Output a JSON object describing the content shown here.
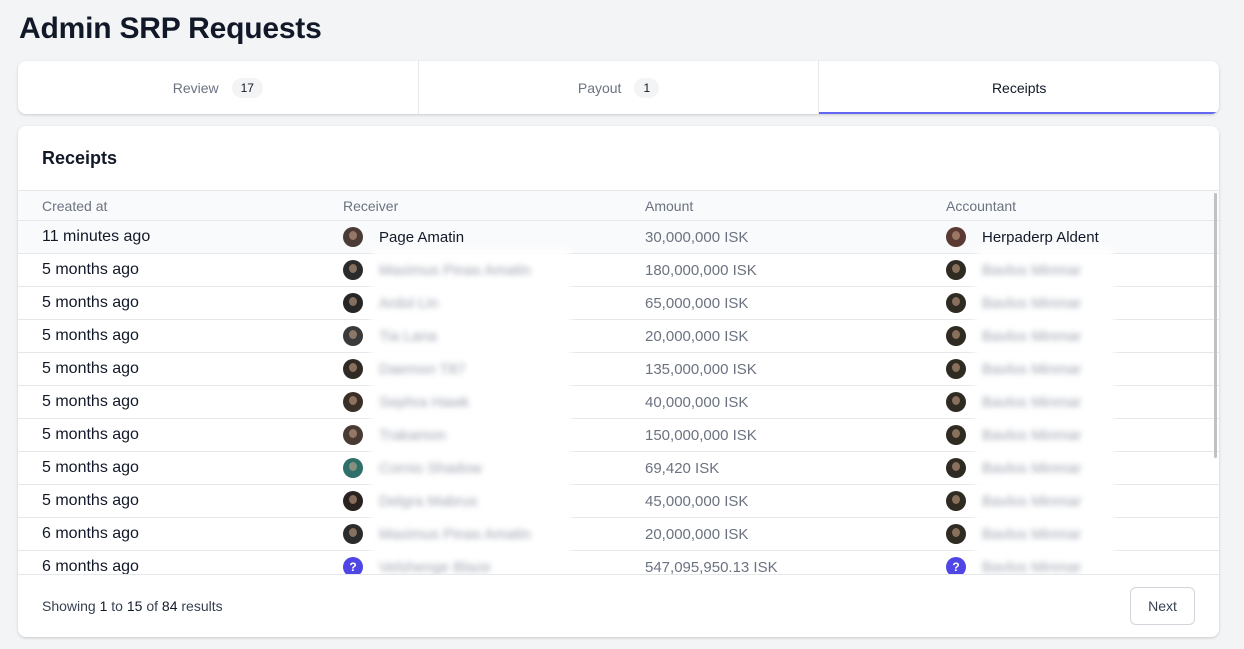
{
  "page": {
    "title": "Admin SRP Requests"
  },
  "tabs": [
    {
      "label": "Review",
      "badge": "17"
    },
    {
      "label": "Payout",
      "badge": "1"
    },
    {
      "label": "Receipts"
    }
  ],
  "receipts": {
    "title": "Receipts",
    "columns": {
      "created": "Created at",
      "receiver": "Receiver",
      "amount": "Amount",
      "accountant": "Accountant"
    },
    "rows": [
      {
        "created": "11 minutes ago",
        "receiver": "Page Amatin",
        "amount": "30,000,000 ISK",
        "accountant": "Herpaderp Aldent",
        "receiver_avatar_color": "#4a3b36",
        "accountant_avatar_color": "#5a3a32"
      },
      {
        "created": "5 months ago",
        "receiver": "Maximus Pinas Amatin",
        "amount": "180,000,000 ISK",
        "accountant": "Bavlos Minmar",
        "receiver_avatar_color": "#2b2b2b",
        "accountant_avatar_color": "#2f2a22"
      },
      {
        "created": "5 months ago",
        "receiver": "Ardol Lin",
        "amount": "65,000,000 ISK",
        "accountant": "Bavlos Minmar",
        "receiver_avatar_color": "#262626",
        "accountant_avatar_color": "#2f2a22"
      },
      {
        "created": "5 months ago",
        "receiver": "Tia Lana",
        "amount": "20,000,000 ISK",
        "accountant": "Bavlos Minmar",
        "receiver_avatar_color": "#3a3a3a",
        "accountant_avatar_color": "#2f2a22"
      },
      {
        "created": "5 months ago",
        "receiver": "Daemon T87",
        "amount": "135,000,000 ISK",
        "accountant": "Bavlos Minmar",
        "receiver_avatar_color": "#302a25",
        "accountant_avatar_color": "#2f2a22"
      },
      {
        "created": "5 months ago",
        "receiver": "Sephra Hawk",
        "amount": "40,000,000 ISK",
        "accountant": "Bavlos Minmar",
        "receiver_avatar_color": "#3b3028",
        "accountant_avatar_color": "#2f2a22"
      },
      {
        "created": "5 months ago",
        "receiver": "Trakamon",
        "amount": "150,000,000 ISK",
        "accountant": "Bavlos Minmar",
        "receiver_avatar_color": "#4a3a34",
        "accountant_avatar_color": "#2f2a22"
      },
      {
        "created": "5 months ago",
        "receiver": "Cornio Shadow",
        "amount": "69,420 ISK",
        "accountant": "Bavlos Minmar",
        "receiver_avatar_color": "#2f6f6a",
        "accountant_avatar_color": "#2f2a22"
      },
      {
        "created": "5 months ago",
        "receiver": "Delgra Mabrus",
        "amount": "45,000,000 ISK",
        "accountant": "Bavlos Minmar",
        "receiver_avatar_color": "#2a2220",
        "accountant_avatar_color": "#2f2a22"
      },
      {
        "created": "6 months ago",
        "receiver": "Maximus Pinas Amatin",
        "amount": "20,000,000 ISK",
        "accountant": "Bavlos Minmar",
        "receiver_avatar_color": "#2b2b2b",
        "accountant_avatar_color": "#2f2a22"
      },
      {
        "created": "6 months ago",
        "receiver": "Velshenge Blaze",
        "amount": "547,095,950.13 ISK",
        "accountant": "Bavlos Minmar",
        "receiver_avatar_unknown": true,
        "accountant_avatar_unknown": true
      }
    ],
    "unknown_avatar_glyph": "?"
  },
  "pagination": {
    "prefix": "Showing",
    "from": "1",
    "to_word": "to",
    "to": "15",
    "of_word": "of",
    "total": "84",
    "suffix": "results",
    "next_label": "Next"
  },
  "colors": {
    "accent": "#6366f1",
    "unknown_avatar": "#4f46e5"
  }
}
